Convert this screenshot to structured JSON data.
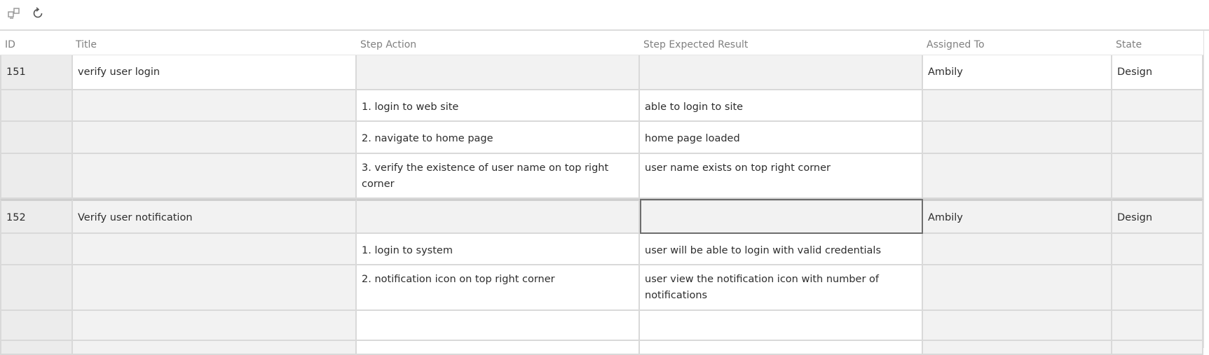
{
  "toolbar": {
    "buttons": [
      {
        "icon": "open-in-queries-icon"
      },
      {
        "icon": "refresh-icon"
      }
    ]
  },
  "columns": [
    "ID",
    "Title",
    "Step Action",
    "Step Expected Result",
    "Assigned To",
    "State"
  ],
  "rows": [
    {
      "id": "151",
      "title": "verify user login",
      "action": "",
      "expected": "",
      "assigned": "Ambily",
      "state": "Design"
    },
    {
      "id": "",
      "title": "",
      "action": "1. login to web site",
      "expected": "able to login to site",
      "assigned": "",
      "state": ""
    },
    {
      "id": "",
      "title": "",
      "action": "2. navigate to home page",
      "expected": "home page loaded",
      "assigned": "",
      "state": ""
    },
    {
      "id": "",
      "title": "",
      "action": "3. verify the existence of user name on top right corner",
      "expected": "user name exists on top right corner",
      "assigned": "",
      "state": ""
    },
    {
      "id": "152",
      "title": "Verify user notification",
      "action": "",
      "expected": "",
      "assigned": "Ambily",
      "state": "Design"
    },
    {
      "id": "",
      "title": "",
      "action": "1. login to system",
      "expected": "user will be able to login with valid credentials",
      "assigned": "",
      "state": ""
    },
    {
      "id": "",
      "title": "",
      "action": "2. notification icon on top right corner",
      "expected": "user view the notification icon with number of notifications",
      "assigned": "",
      "state": ""
    },
    {
      "id": "",
      "title": "",
      "action": "",
      "expected": "",
      "assigned": "",
      "state": ""
    },
    {
      "id": "",
      "title": "",
      "action": "",
      "expected": "",
      "assigned": "",
      "state": ""
    }
  ]
}
